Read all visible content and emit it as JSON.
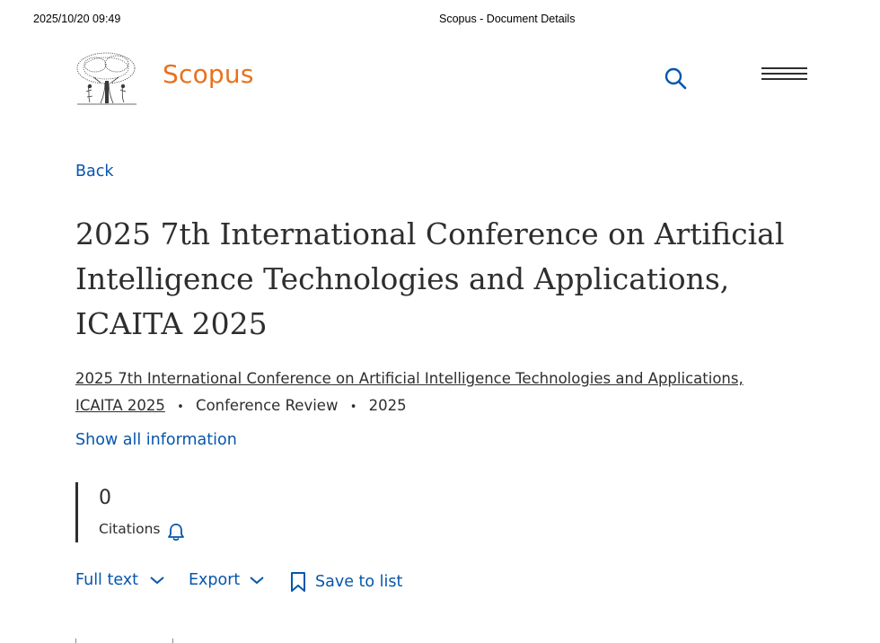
{
  "print_header": {
    "timestamp": "2025/10/20 09:49",
    "page_title": "Scopus - Document Details"
  },
  "header": {
    "brand": "Scopus",
    "logo_icon": "elsevier-tree-logo",
    "search_icon": "search-icon",
    "menu_icon": "hamburger-menu-icon"
  },
  "nav": {
    "back_label": "Back"
  },
  "document": {
    "title": "2025 7th International Conference on Artificial Intelligence Technologies and Applications, ICAITA 2025",
    "source_title": "2025 7th International Conference on Artificial Intelligence Technologies and Applications, ICAITA 2025",
    "document_type": "Conference Review",
    "year": "2025",
    "separator": "•",
    "show_all_label": "Show all information"
  },
  "metrics": {
    "citations_value": "0",
    "citations_label": "Citations"
  },
  "actions": {
    "full_text_label": "Full text",
    "export_label": "Export",
    "save_to_list_label": "Save to list"
  },
  "colors": {
    "brand_orange": "#e9711c",
    "link_blue": "#0656ad",
    "text_dark": "#2e2e2e"
  }
}
